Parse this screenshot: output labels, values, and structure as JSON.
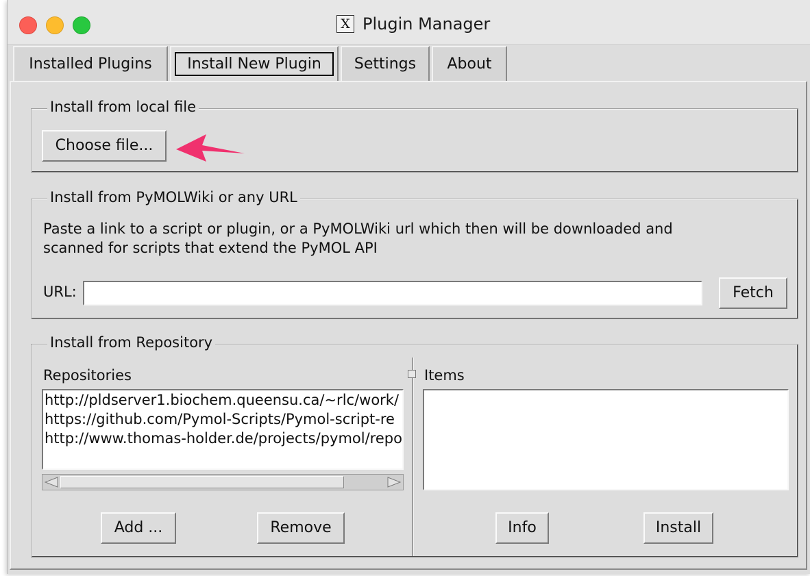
{
  "window": {
    "title": "Plugin Manager",
    "title_icon": "X"
  },
  "tabs": [
    {
      "label": "Installed Plugins"
    },
    {
      "label": "Install New Plugin"
    },
    {
      "label": "Settings"
    },
    {
      "label": "About"
    }
  ],
  "local_file": {
    "legend": "Install from local file",
    "choose_label": "Choose file...",
    "arrow_color": "#f0316e"
  },
  "url_section": {
    "legend": "Install from PyMOLWiki or any URL",
    "description_line1": "Paste a link to a script or plugin, or a PyMOLWiki url which then will be downloaded and",
    "description_line2": "scanned for scripts that extend the PyMOL API",
    "url_label": "URL:",
    "url_value": "",
    "fetch_label": "Fetch"
  },
  "repository": {
    "legend": "Install from Repository",
    "repositories_label": "Repositories",
    "repositories": [
      "http://pldserver1.biochem.queensu.ca/~rlc/work/",
      "https://github.com/Pymol-Scripts/Pymol-script-re",
      "http://www.thomas-holder.de/projects/pymol/repo"
    ],
    "add_label": "Add ...",
    "remove_label": "Remove",
    "items_label": "Items",
    "info_label": "Info",
    "install_label": "Install"
  }
}
